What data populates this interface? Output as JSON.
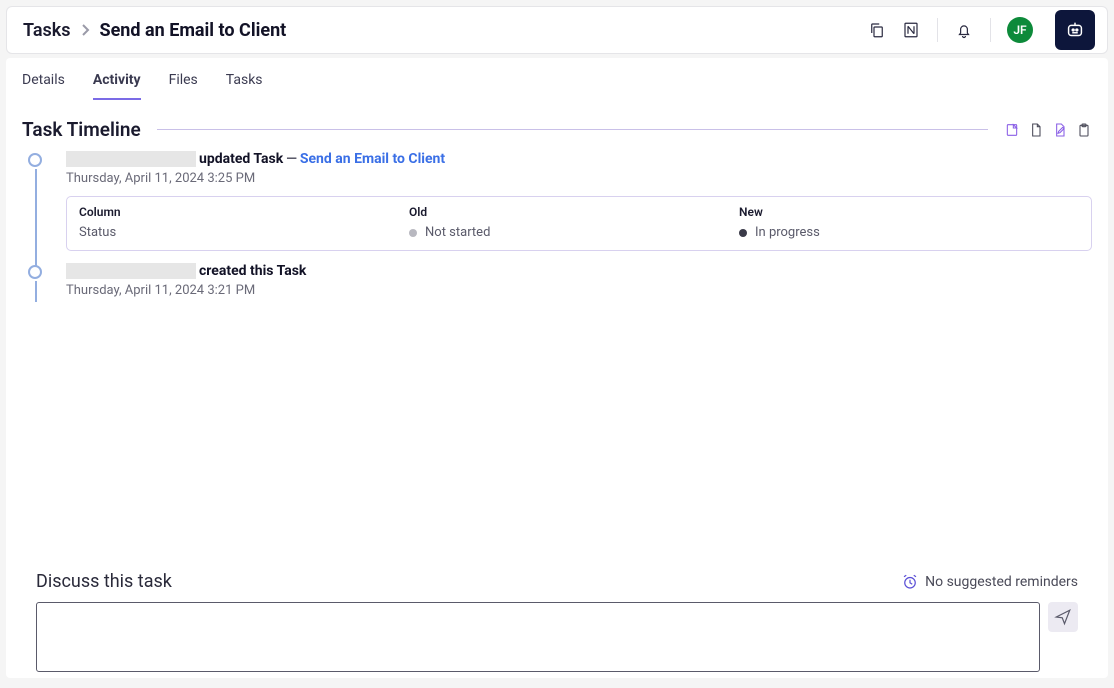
{
  "breadcrumb": {
    "root": "Tasks",
    "title": "Send an Email to Client"
  },
  "avatar_initials": "JF",
  "tabs": {
    "details": "Details",
    "activity": "Activity",
    "files": "Files",
    "tasks": "Tasks"
  },
  "section_title": "Task Timeline",
  "timeline": [
    {
      "action": "updated Task",
      "link_text": "Send an Email to Client",
      "timestamp": "Thursday, April 11, 2024 3:25 PM",
      "change": {
        "col_head": "Column",
        "old_head": "Old",
        "new_head": "New",
        "column": "Status",
        "old": "Not started",
        "new": "In progress"
      }
    },
    {
      "action": "created this Task",
      "timestamp": "Thursday, April 11, 2024 3:21 PM"
    }
  ],
  "discuss": {
    "title": "Discuss this task",
    "reminders": "No suggested reminders",
    "placeholder": ""
  }
}
